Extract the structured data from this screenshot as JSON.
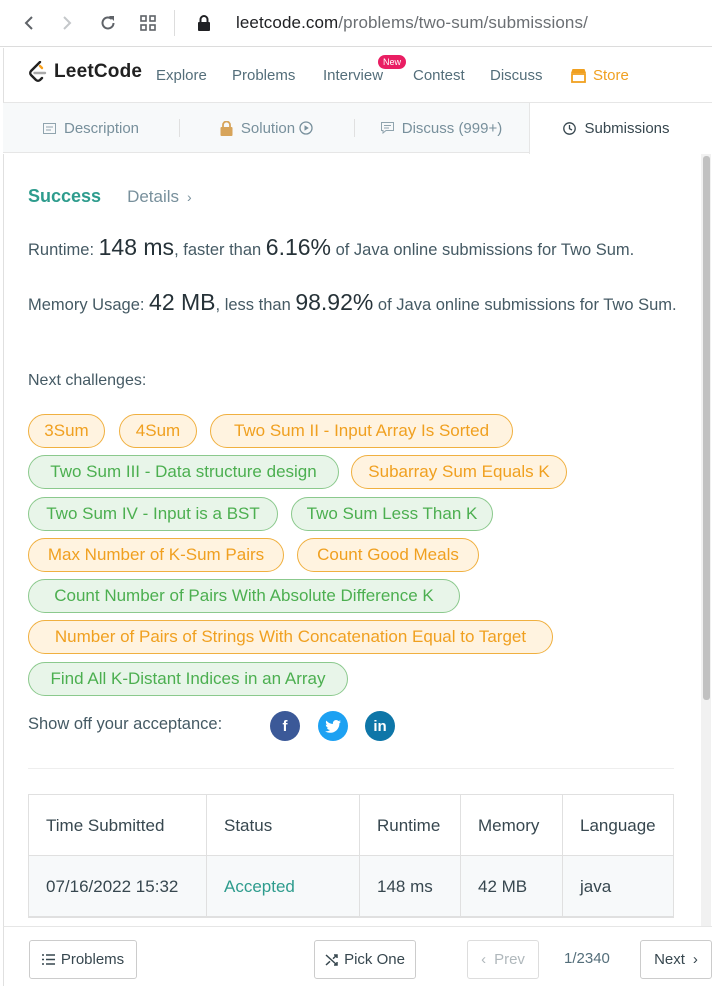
{
  "browser": {
    "url_host": "leetcode.com",
    "url_path": "/problems/two-sum/submissions/"
  },
  "nav": {
    "logo": "LeetCode",
    "links": [
      "Explore",
      "Problems",
      "Interview",
      "Contest",
      "Discuss"
    ],
    "new_badge": "New",
    "store": "Store"
  },
  "tabs": {
    "description": "Description",
    "solution": "Solution",
    "discuss": "Discuss (999+)",
    "submissions": "Submissions"
  },
  "result": {
    "status": "Success",
    "details": "Details",
    "runtime_label": "Runtime:",
    "runtime_value": "148 ms",
    "runtime_mid": ", faster than ",
    "runtime_pct": "6.16%",
    "runtime_tail": " of Java online submissions for Two Sum.",
    "memory_label": "Memory Usage:",
    "memory_value": "42 MB",
    "memory_mid": ", less than ",
    "memory_pct": "98.92%",
    "memory_tail": " of Java online submissions for Two Sum."
  },
  "next_challenges_label": "Next challenges:",
  "challenges": [
    {
      "label": "3Sum",
      "difficulty": "medium"
    },
    {
      "label": "4Sum",
      "difficulty": "medium"
    },
    {
      "label": "Two Sum II - Input Array Is Sorted",
      "difficulty": "medium"
    },
    {
      "label": "Two Sum III - Data structure design",
      "difficulty": "easy"
    },
    {
      "label": "Subarray Sum Equals K",
      "difficulty": "medium"
    },
    {
      "label": "Two Sum IV - Input is a BST",
      "difficulty": "easy"
    },
    {
      "label": "Two Sum Less Than K",
      "difficulty": "easy"
    },
    {
      "label": "Max Number of K-Sum Pairs",
      "difficulty": "medium"
    },
    {
      "label": "Count Good Meals",
      "difficulty": "medium"
    },
    {
      "label": "Count Number of Pairs With Absolute Difference K",
      "difficulty": "easy"
    },
    {
      "label": "Number of Pairs of Strings With Concatenation Equal to Target",
      "difficulty": "medium"
    },
    {
      "label": "Find All K-Distant Indices in an Array",
      "difficulty": "easy"
    }
  ],
  "share_label": "Show off your acceptance:",
  "social": [
    {
      "name": "facebook",
      "glyph": "f",
      "color": "#3b5998"
    },
    {
      "name": "twitter",
      "glyph": "t",
      "color": "#1da1f2"
    },
    {
      "name": "linkedin",
      "glyph": "in",
      "color": "#0e76a8"
    }
  ],
  "table": {
    "headers": [
      "Time Submitted",
      "Status",
      "Runtime",
      "Memory",
      "Language"
    ],
    "rows": [
      [
        "07/16/2022 15:32",
        "Accepted",
        "148 ms",
        "42 MB",
        "java"
      ]
    ]
  },
  "bottom": {
    "problems": "Problems",
    "pick_one": "Pick One",
    "prev": "Prev",
    "page": "1/2340",
    "next": "Next"
  },
  "colors": {
    "accent_teal": "#2e9c8d",
    "medium_orange": "#f0a020",
    "easy_green": "#4caf50"
  }
}
